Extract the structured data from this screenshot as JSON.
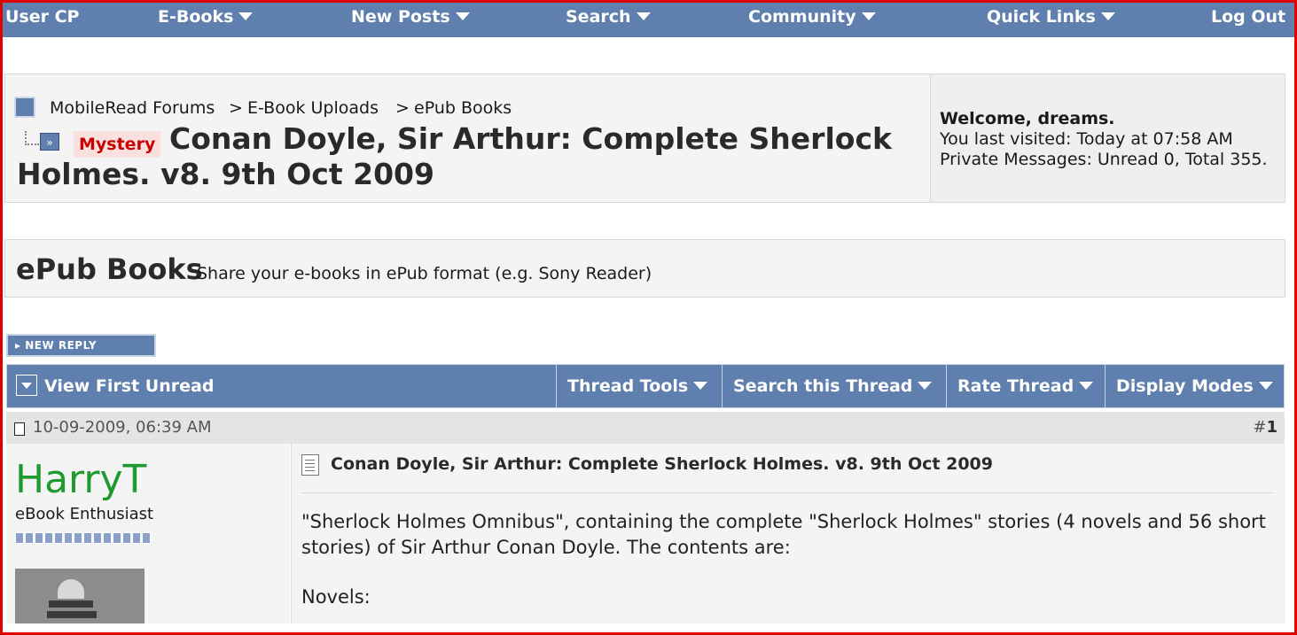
{
  "navbar": {
    "items": [
      "User CP",
      "E-Books",
      "New Posts",
      "Search",
      "Community",
      "Quick Links",
      "Log Out"
    ]
  },
  "breadcrumb": {
    "items": [
      "MobileRead Forums",
      "E-Book Uploads",
      "ePub Books"
    ],
    "separator": ">"
  },
  "thread": {
    "prefix": "Mystery",
    "title": "Conan Doyle, Sir Arthur: Complete Sherlock Holmes. v8. 9th Oct 2009"
  },
  "welcome": {
    "greeting": "Welcome, dreams.",
    "last_visited": "You last visited: Today at 07:58 AM",
    "private_messages": "Private Messages: Unread 0, Total 355."
  },
  "forum": {
    "title": "ePub Books",
    "description": "Share your e-books in ePub format (e.g. Sony Reader)"
  },
  "new_reply_label": "NEW REPLY",
  "toolbar": {
    "view_first_unread": "View First Unread",
    "thread_tools": "Thread Tools",
    "search_thread": "Search this Thread",
    "rate_thread": "Rate Thread",
    "display_modes": "Display Modes"
  },
  "post": {
    "date": "10-09-2009, 06:39 AM",
    "number_prefix": "#",
    "number": "1",
    "username": "HarryT",
    "user_title": "eBook Enthusiast",
    "reputation_pips": 14,
    "title": "Conan Doyle, Sir Arthur: Complete Sherlock Holmes. v8. 9th Oct 2009",
    "body": "\"Sherlock Holmes Omnibus\", containing the complete \"Sherlock Holmes\" stories (4 novels and 56 short stories) of Sir Arthur Conan Doyle. The contents are:",
    "novels_heading": "Novels:"
  },
  "colors": {
    "nav_blue": "#5f7fae",
    "frame_red": "#e00000",
    "username_green": "#1f9a2e",
    "prefix_red": "#c80000"
  }
}
